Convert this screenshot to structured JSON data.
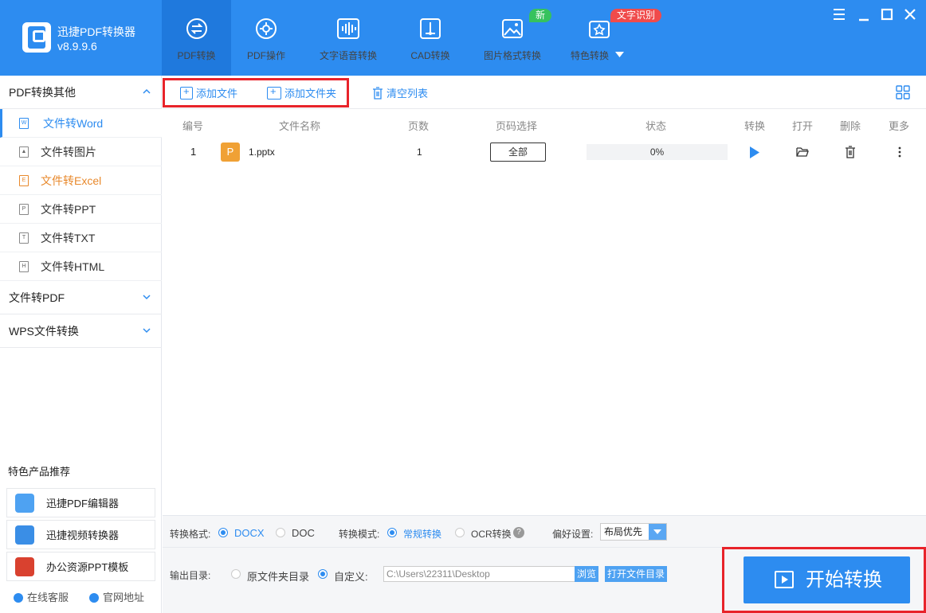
{
  "app": {
    "name": "迅捷PDF转换器",
    "version": "v8.9.9.6"
  },
  "nav": {
    "tabs": [
      {
        "label": "PDF转换",
        "icon": "pdf-convert-icon",
        "active": true
      },
      {
        "label": "PDF操作",
        "icon": "pdf-gear-icon"
      },
      {
        "label": "文字语音转换",
        "icon": "audio-wave-icon"
      },
      {
        "label": "CAD转换",
        "icon": "cad-icon"
      },
      {
        "label": "图片格式转换",
        "icon": "image-icon"
      },
      {
        "label": "特色转换",
        "icon": "special-convert-icon"
      }
    ],
    "badge_new": "新",
    "badge_ocr": "文字识别"
  },
  "sidebar": {
    "group_pdf_other": "PDF转换其他",
    "items": [
      {
        "label": "文件转Word",
        "icon_letter": "W"
      },
      {
        "label": "文件转图片",
        "icon_letter": ""
      },
      {
        "label": "文件转Excel",
        "icon_letter": "E"
      },
      {
        "label": "文件转PPT",
        "icon_letter": "P"
      },
      {
        "label": "文件转TXT",
        "icon_letter": "T"
      },
      {
        "label": "文件转HTML",
        "icon_letter": "H"
      }
    ],
    "group_to_pdf": "文件转PDF",
    "group_wps": "WPS文件转换",
    "recommend_title": "特色产品推荐",
    "recommend": [
      "迅捷PDF编辑器",
      "迅捷视频转换器",
      "办公资源PPT模板"
    ],
    "footer_service": "在线客服",
    "footer_site": "官网地址"
  },
  "toolbar": {
    "add_file": "添加文件",
    "add_folder": "添加文件夹",
    "clear_list": "清空列表"
  },
  "table": {
    "headers": [
      "编号",
      "文件名称",
      "页数",
      "页码选择",
      "状态",
      "转换",
      "打开",
      "删除",
      "更多"
    ],
    "rows": [
      {
        "index": "1",
        "icon_letter": "P",
        "name": "1.pptx",
        "pages": "1",
        "page_select": "全部",
        "progress_text": "0%",
        "progress": 0
      }
    ]
  },
  "options": {
    "format_label": "转换格式:",
    "format_docx": "DOCX",
    "format_doc": "DOC",
    "mode_label": "转换模式:",
    "mode_normal": "常规转换",
    "mode_ocr": "OCR转换",
    "help_mark": "?",
    "pref_label": "偏好设置:",
    "pref_value": "布局优先"
  },
  "output": {
    "label": "输出目录:",
    "opt_source": "原文件夹目录",
    "opt_custom": "自定义:",
    "path": "C:\\Users\\22311\\Desktop",
    "browse": "浏览",
    "open_dir": "打开文件目录"
  },
  "start_button": "开始转换",
  "colors": {
    "primary": "#2d8cf0",
    "highlight": "#e8232a",
    "badge_new": "#36c25e",
    "badge_ocr": "#f04b4b"
  }
}
